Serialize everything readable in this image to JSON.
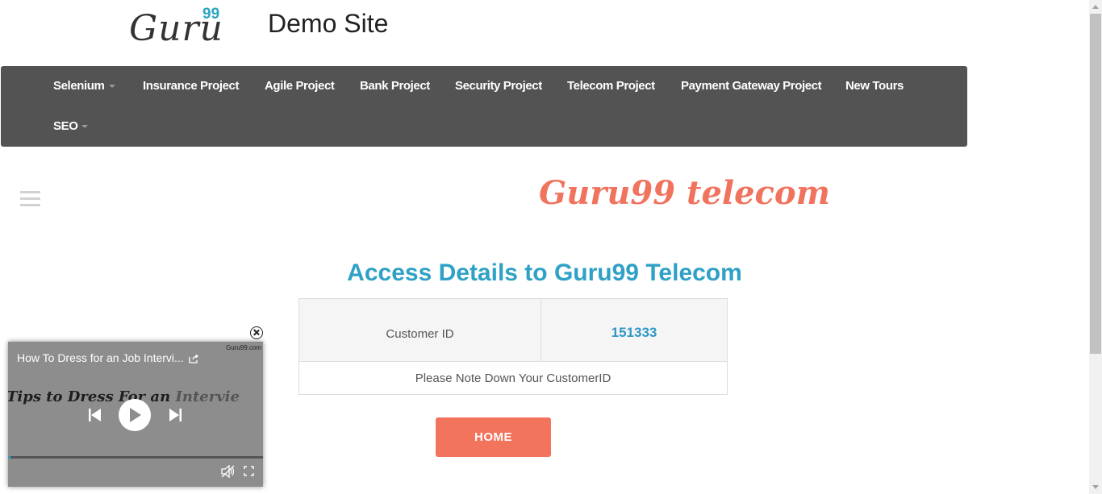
{
  "header": {
    "logo_word": "Guru",
    "logo_number": "99",
    "site_title": "Demo Site"
  },
  "nav": {
    "items": [
      {
        "label": "Selenium",
        "dropdown": true
      },
      {
        "label": "Insurance Project",
        "dropdown": false
      },
      {
        "label": "Agile Project",
        "dropdown": false
      },
      {
        "label": "Bank Project",
        "dropdown": false
      },
      {
        "label": "Security Project",
        "dropdown": false
      },
      {
        "label": "Telecom Project",
        "dropdown": false
      },
      {
        "label": "Payment Gateway Project",
        "dropdown": false
      },
      {
        "label": "New Tours",
        "dropdown": false
      },
      {
        "label": "SEO",
        "dropdown": true
      }
    ]
  },
  "main": {
    "brand_title": "Guru99 telecom",
    "heading": "Access Details to Guru99 Telecom",
    "table": {
      "label": "Customer ID",
      "value": "151333",
      "note": "Please Note Down Your CustomerID"
    },
    "home_button": "HOME"
  },
  "video": {
    "title": "How To Dress for an Job Intervi...",
    "brand": "Guru99.com",
    "frame_text_main": "Tips to Dress For an ",
    "frame_text_fade": "Intervie",
    "progress": 0.01
  },
  "colors": {
    "accent_blue": "#2fa1c6",
    "accent_orange": "#f2745c",
    "nav_background": "#535353"
  },
  "icons": [
    "menu-icon",
    "close-circle-icon",
    "share-icon",
    "previous-icon",
    "play-icon",
    "next-icon",
    "mute-icon",
    "fullscreen-icon"
  ]
}
